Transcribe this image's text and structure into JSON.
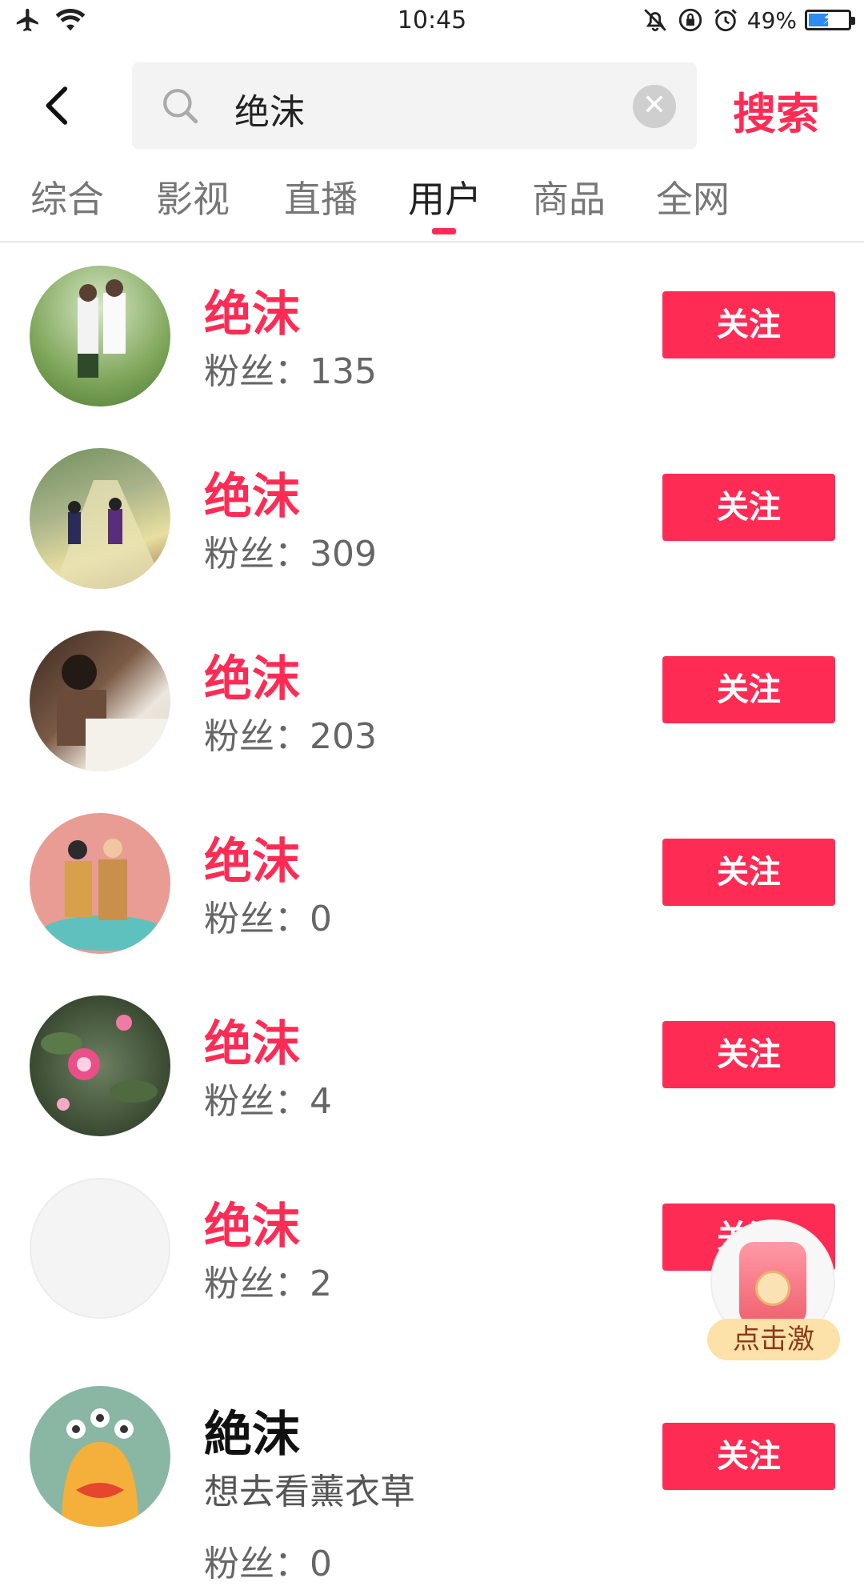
{
  "status_bar": {
    "time": "10:45",
    "battery_percent": "49%",
    "battery_level": 0.49,
    "icons": [
      "airplane-icon",
      "wifi-icon",
      "mute-icon",
      "rotation-lock-icon",
      "alarm-icon",
      "battery-icon"
    ]
  },
  "search": {
    "query": "绝沫",
    "submit_label": "搜索"
  },
  "tabs": [
    {
      "label": "综合"
    },
    {
      "label": "影视"
    },
    {
      "label": "直播"
    },
    {
      "label": "用户",
      "active": true
    },
    {
      "label": "商品"
    },
    {
      "label": "全网"
    }
  ],
  "users": [
    {
      "name": "绝沫",
      "fans": "粉丝：135",
      "follow": "关注"
    },
    {
      "name": "绝沫",
      "fans": "粉丝：309",
      "follow": "关注"
    },
    {
      "name": "绝沫",
      "fans": "粉丝：203",
      "follow": "关注"
    },
    {
      "name": "绝沫",
      "fans": "粉丝：0",
      "follow": "关注"
    },
    {
      "name": "绝沫",
      "fans": "粉丝：4",
      "follow": "关注"
    },
    {
      "name": "绝沫",
      "fans": "粉丝：2",
      "follow": "关注"
    },
    {
      "name": "絶沫",
      "bio": "想去看薰衣草",
      "fans": "粉丝：0",
      "follow": "关注"
    }
  ],
  "floating_promo": {
    "label": "点击激"
  },
  "colors": {
    "accent": "#fe2c55",
    "tab_indicator": "#fe2c55",
    "search_bg": "#f3f3f3"
  }
}
